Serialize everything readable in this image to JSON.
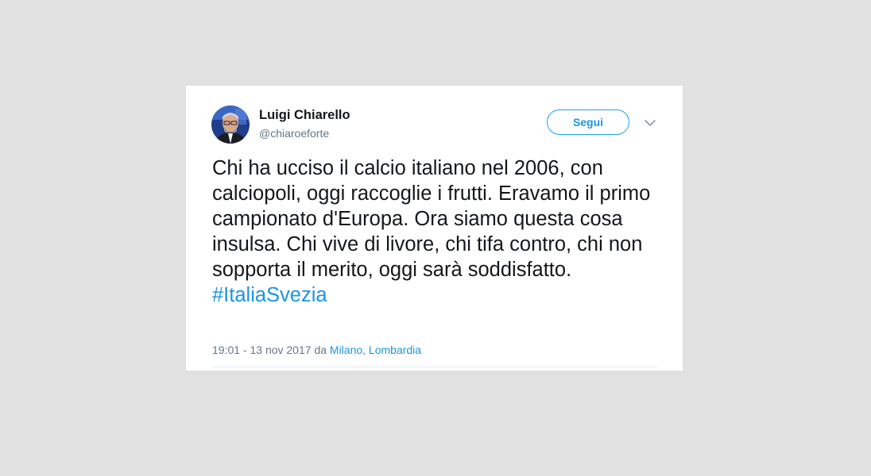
{
  "tweet": {
    "author": {
      "display_name": "Luigi Chiarello",
      "handle": "@chiaroeforte",
      "avatar_icon": "profile-photo"
    },
    "follow_label": "Segui",
    "menu_icon": "chevron-down-icon",
    "text": "Chi ha ucciso il calcio italiano nel 2006, con calciopoli, oggi raccoglie i frutti. Eravamo il primo campionato d'Europa. Ora siamo questa cosa insulsa. Chi vive di livore, chi tifa contro, chi non sopporta il merito, oggi sarà soddisfatto.",
    "hashtag": "#ItaliaSvezia",
    "timestamp": "19:01 - 13 nov 2017",
    "location_prefix": "da",
    "location": "Milano, Lombardia"
  },
  "colors": {
    "background": "#e1e1e1",
    "card": "#ffffff",
    "accent": "#1da1f2",
    "link": "#1b95e0",
    "text": "#14171a",
    "muted": "#657786"
  }
}
